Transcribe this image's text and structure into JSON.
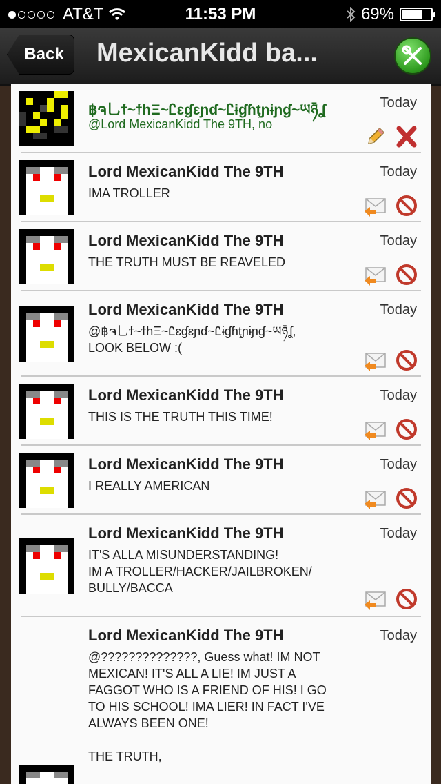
{
  "status_bar": {
    "carrier": "AT&T",
    "time": "11:53 PM",
    "battery": "69%",
    "battery_level": 0.69
  },
  "nav": {
    "back_label": "Back",
    "title": "MexicanKidd ba..."
  },
  "messages": [
    {
      "author": "฿ຈ乚ϯ~ϯhΞ~Ꮭɛɠɛɲɗ~Ꮭɨɠɦţɲɨɲɠ~ཡཉ̄ʆ",
      "time": "Today",
      "text": "@Lord MexicanKidd The 9TH, no",
      "actions": [
        "edit",
        "delete"
      ]
    },
    {
      "author": "Lord MexicanKidd The 9TH",
      "time": "Today",
      "text": "IMA TROLLER",
      "actions": [
        "reply",
        "block"
      ]
    },
    {
      "author": "Lord MexicanKidd The 9TH",
      "time": "Today",
      "text": "THE TRUTH MUST BE REAVELED",
      "actions": [
        "reply",
        "block"
      ]
    },
    {
      "author": "Lord MexicanKidd The 9TH",
      "time": "Today",
      "text": "@฿ຈ乚ϯ~ϯhΞ~Ꮭɛɠɛɲɗ~Ꮭɨɠɦţɲɨɲɠ~ཡཉ̄ʆ,\nLOOK BELOW :(",
      "actions": [
        "reply",
        "block"
      ]
    },
    {
      "author": "Lord MexicanKidd The 9TH",
      "time": "Today",
      "text": "THIS IS THE TRUTH THIS TIME!",
      "actions": [
        "reply",
        "block"
      ]
    },
    {
      "author": "Lord MexicanKidd The 9TH",
      "time": "Today",
      "text": "I REALLY AMERICAN",
      "actions": [
        "reply",
        "block"
      ]
    },
    {
      "author": "Lord MexicanKidd The 9TH",
      "time": "Today",
      "text": "IT'S ALLA MISUNDERSTANDING!\nIM A TROLLER/HACKER/JAILBROKEN/\nBULLY/BACCA",
      "actions": [
        "reply",
        "block"
      ]
    },
    {
      "author": "Lord MexicanKidd The 9TH",
      "time": "Today",
      "text": "@??????????????, Guess what! IM NOT\nMEXICAN! IT'S ALL A LIE! IM JUST A\nFAGGOT WHO IS A FRIEND OF HIS! I GO\nTO HIS SCHOOL! IMA LIER! IN FACT I'VE\nALWAYS BEEN ONE!\n\nTHE TRUTH,",
      "actions": []
    }
  ]
}
